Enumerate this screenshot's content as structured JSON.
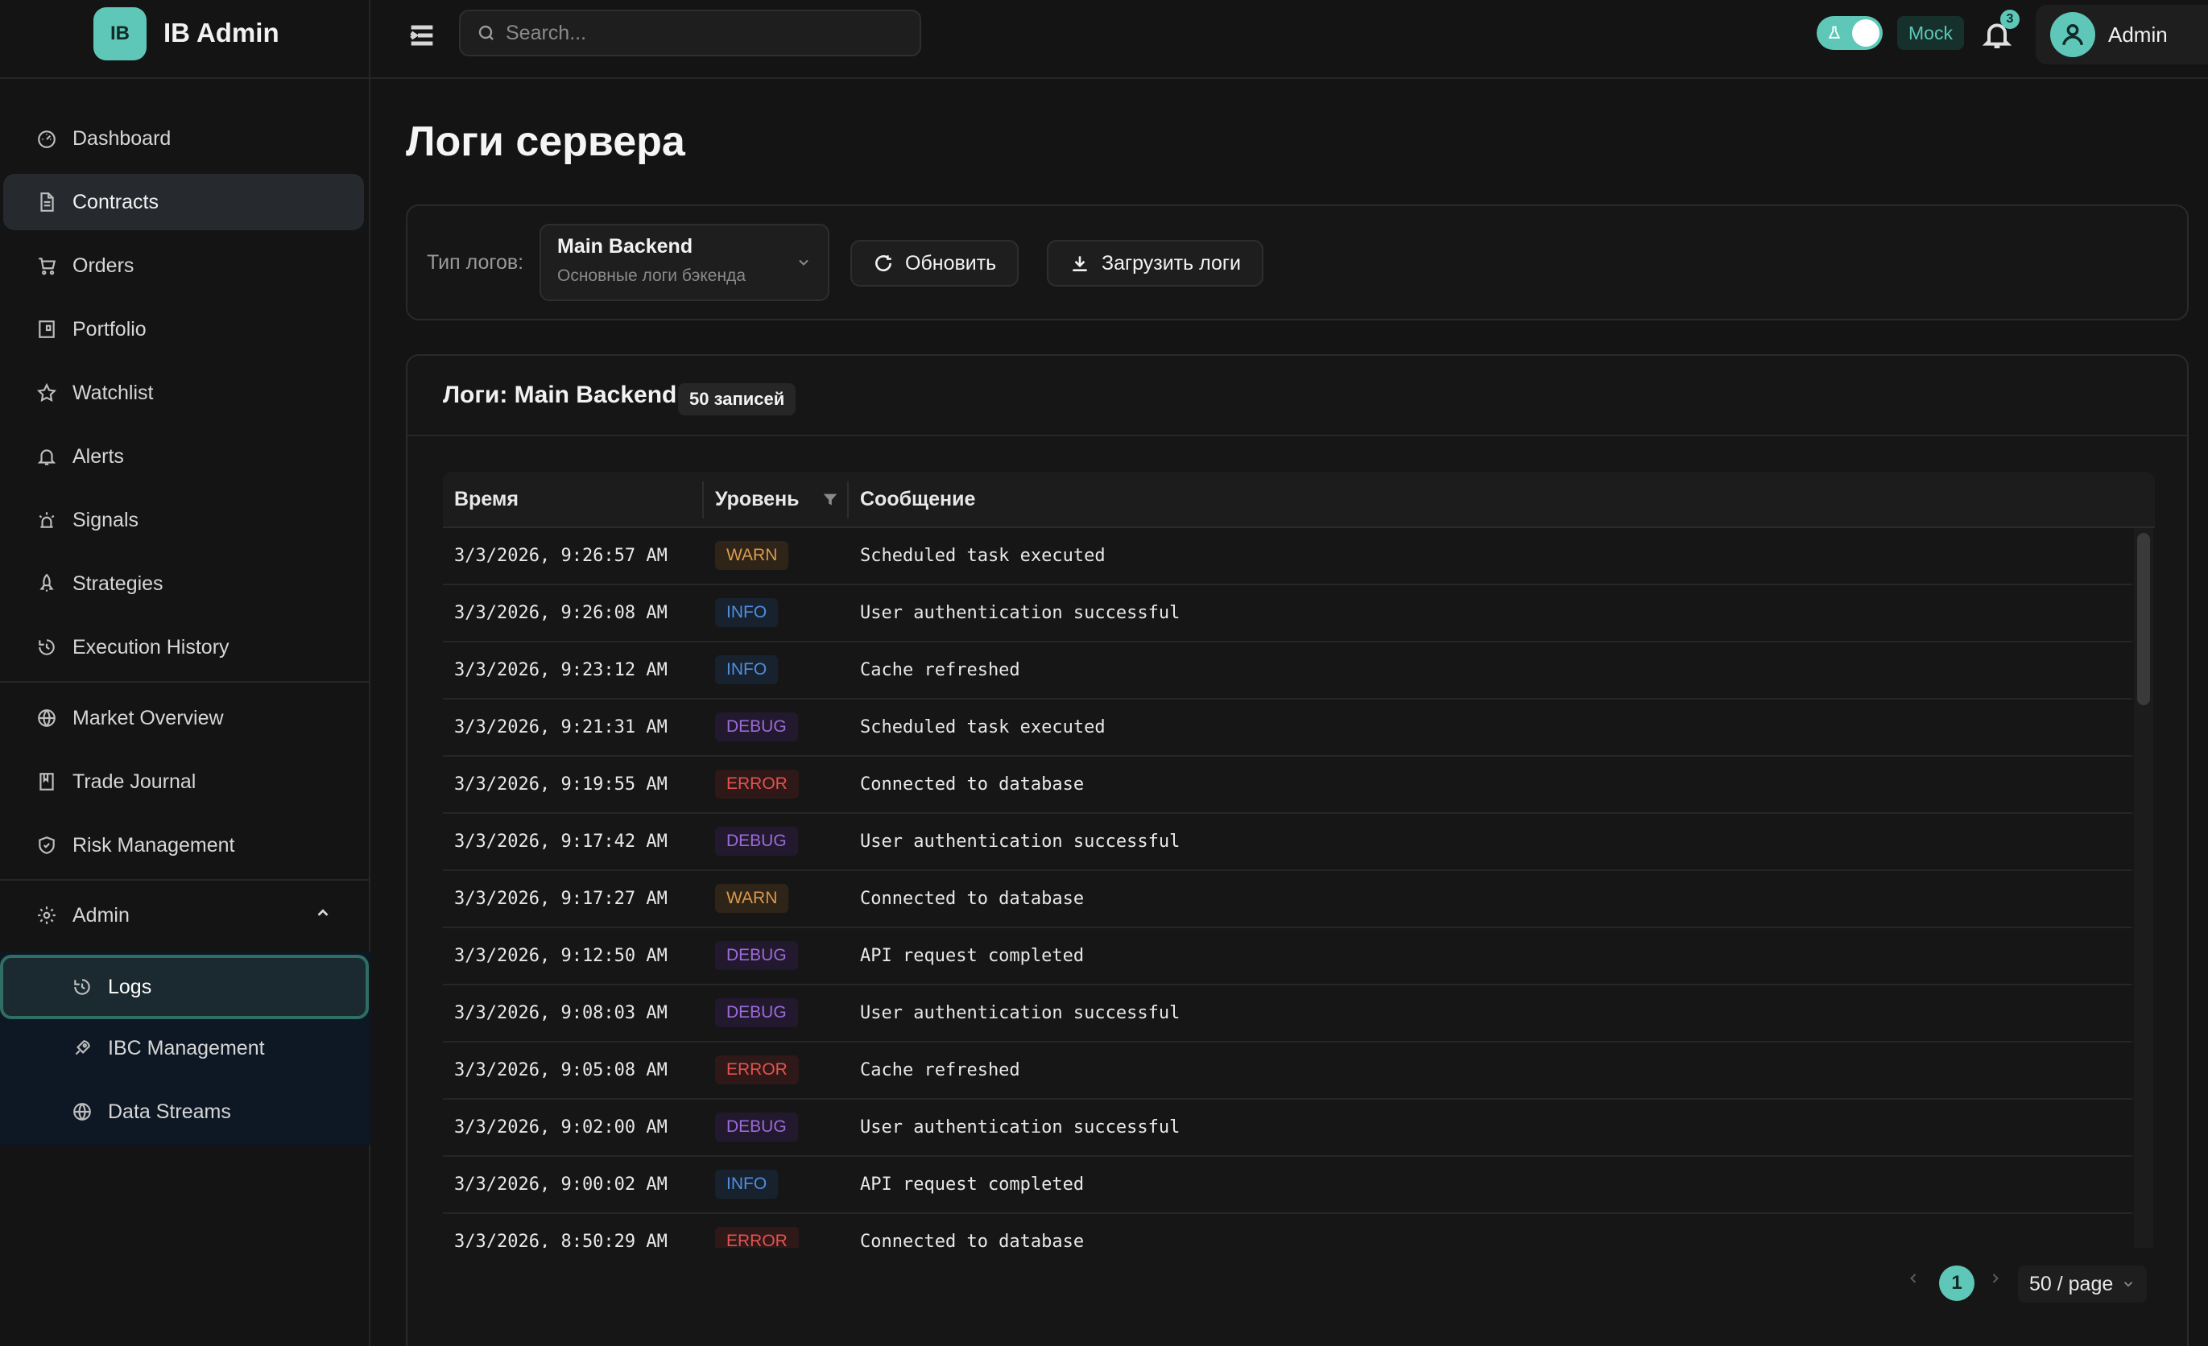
{
  "brand": {
    "logo": "IB",
    "name": "IB Admin"
  },
  "sidebar": {
    "items": [
      {
        "label": "Dashboard",
        "icon": "dashboard-icon"
      },
      {
        "label": "Contracts",
        "icon": "file-icon"
      },
      {
        "label": "Orders",
        "icon": "cart-icon"
      },
      {
        "label": "Portfolio",
        "icon": "portfolio-icon"
      },
      {
        "label": "Watchlist",
        "icon": "star-icon"
      },
      {
        "label": "Alerts",
        "icon": "bell-icon"
      },
      {
        "label": "Signals",
        "icon": "signal-icon"
      },
      {
        "label": "Strategies",
        "icon": "rocket-icon"
      },
      {
        "label": "Execution History",
        "icon": "history-icon"
      },
      {
        "label": "Market Overview",
        "icon": "globe-icon"
      },
      {
        "label": "Trade Journal",
        "icon": "book-icon"
      },
      {
        "label": "Risk Management",
        "icon": "shield-icon"
      },
      {
        "label": "Admin",
        "icon": "gear-icon"
      }
    ],
    "submenu": [
      {
        "label": "Logs",
        "icon": "history-icon"
      },
      {
        "label": "IBC Management",
        "icon": "rocket-icon"
      },
      {
        "label": "Data Streams",
        "icon": "globe-icon"
      }
    ]
  },
  "header": {
    "search_placeholder": "Search...",
    "mode_label": "Mock",
    "notifications_count": "3",
    "user_name": "Admin"
  },
  "page": {
    "title": "Логи сервера",
    "filter_label": "Тип логов:",
    "select_value": "Main Backend",
    "select_description": "Основные логи бэкенда",
    "refresh_label": "Обновить",
    "download_label": "Загрузить логи"
  },
  "logs": {
    "title": "Логи: Main Backend",
    "count_badge": "50 записей",
    "columns": [
      "Время",
      "Уровень",
      "Сообщение"
    ],
    "rows": [
      {
        "time": "3/3/2026, 9:26:57 AM",
        "level": "WARN",
        "message": "Scheduled task executed"
      },
      {
        "time": "3/3/2026, 9:26:08 AM",
        "level": "INFO",
        "message": "User authentication successful"
      },
      {
        "time": "3/3/2026, 9:23:12 AM",
        "level": "INFO",
        "message": "Cache refreshed"
      },
      {
        "time": "3/3/2026, 9:21:31 AM",
        "level": "DEBUG",
        "message": "Scheduled task executed"
      },
      {
        "time": "3/3/2026, 9:19:55 AM",
        "level": "ERROR",
        "message": "Connected to database"
      },
      {
        "time": "3/3/2026, 9:17:42 AM",
        "level": "DEBUG",
        "message": "User authentication successful"
      },
      {
        "time": "3/3/2026, 9:17:27 AM",
        "level": "WARN",
        "message": "Connected to database"
      },
      {
        "time": "3/3/2026, 9:12:50 AM",
        "level": "DEBUG",
        "message": "API request completed"
      },
      {
        "time": "3/3/2026, 9:08:03 AM",
        "level": "DEBUG",
        "message": "User authentication successful"
      },
      {
        "time": "3/3/2026, 9:05:08 AM",
        "level": "ERROR",
        "message": "Cache refreshed"
      },
      {
        "time": "3/3/2026, 9:02:00 AM",
        "level": "DEBUG",
        "message": "User authentication successful"
      },
      {
        "time": "3/3/2026, 9:00:02 AM",
        "level": "INFO",
        "message": "API request completed"
      },
      {
        "time": "3/3/2026, 8:50:29 AM",
        "level": "ERROR",
        "message": "Connected to database"
      }
    ]
  },
  "pagination": {
    "current_page": "1",
    "page_size": "50 / page"
  },
  "colors": {
    "accent": "#5ec7b7",
    "warn": "#d99a4e",
    "info": "#4f8ee0",
    "debug": "#9b6bd8",
    "error": "#e0544f"
  }
}
